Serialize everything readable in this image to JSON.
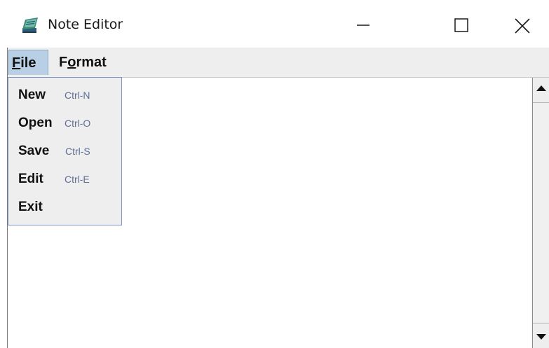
{
  "window": {
    "title": "Note Editor",
    "icon": "notepad-icon",
    "controls": [
      "minimize-icon",
      "maximize-icon",
      "close-icon"
    ]
  },
  "menubar": {
    "file": {
      "mnemonic": "F",
      "rest": "ile"
    },
    "format": {
      "before": "F",
      "mnemonic": "o",
      "rest": "rmat"
    }
  },
  "file_menu": {
    "items": [
      {
        "label": "New",
        "shortcut": "Ctrl-N"
      },
      {
        "label": "Open",
        "shortcut": "Ctrl-O"
      },
      {
        "label": "Save",
        "shortcut": "Ctrl-S"
      },
      {
        "label": "Edit",
        "shortcut": "Ctrl-E"
      },
      {
        "label": "Exit",
        "shortcut": ""
      }
    ]
  },
  "editor": {
    "text": ""
  },
  "colors": {
    "menu_selected": "#b8cfe5",
    "menu_background": "#eeeeee",
    "shortcut_text": "#5d6f96",
    "dropdown_border": "#7b96c6"
  }
}
